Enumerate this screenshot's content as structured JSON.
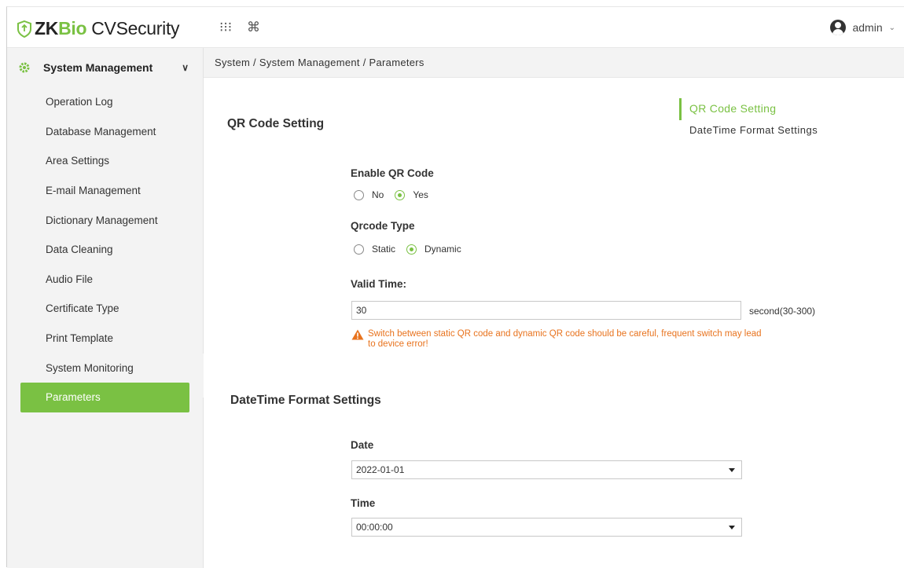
{
  "header": {
    "logo_zk": "ZK",
    "logo_bio": "Bio",
    "logo_rest": "CVSecurity",
    "apps_icon": "grid-icon",
    "shortcut_icon": "command-icon",
    "user_name": "admin"
  },
  "sidebar": {
    "module_title": "System Management",
    "items": [
      {
        "label": "Operation Log"
      },
      {
        "label": "Database Management"
      },
      {
        "label": "Area Settings"
      },
      {
        "label": "E-mail Management"
      },
      {
        "label": "Dictionary Management"
      },
      {
        "label": "Data Cleaning"
      },
      {
        "label": "Audio File"
      },
      {
        "label": "Certificate Type"
      },
      {
        "label": "Print Template"
      },
      {
        "label": "System Monitoring"
      },
      {
        "label": "Parameters",
        "active": true
      }
    ],
    "collapse_label": "«"
  },
  "breadcrumb": "System / System Management / Parameters",
  "anchors": {
    "qr": "QR Code Setting",
    "datetime": "DateTime Format Settings"
  },
  "qr_section": {
    "title": "QR Code Setting",
    "enable_label": "Enable QR Code",
    "enable_options": {
      "no": "No",
      "yes": "Yes"
    },
    "enable_value": "Yes",
    "type_label": "Qrcode Type",
    "type_options": {
      "static": "Static",
      "dynamic": "Dynamic"
    },
    "type_value": "Dynamic",
    "valid_time_label": "Valid Time:",
    "valid_time_value": "30",
    "valid_time_unit": "second(30-300)",
    "warning_line1": "Switch between static QR code and dynamic QR code should be careful, frequent switch may lead",
    "warning_line2": "to device error!"
  },
  "datetime_section": {
    "title": "DateTime Format Settings",
    "date_label": "Date",
    "date_value": "2022-01-01",
    "time_label": "Time",
    "time_value": "00:00:00"
  },
  "colors": {
    "accent": "#7ac143",
    "warning": "#e8731e"
  }
}
